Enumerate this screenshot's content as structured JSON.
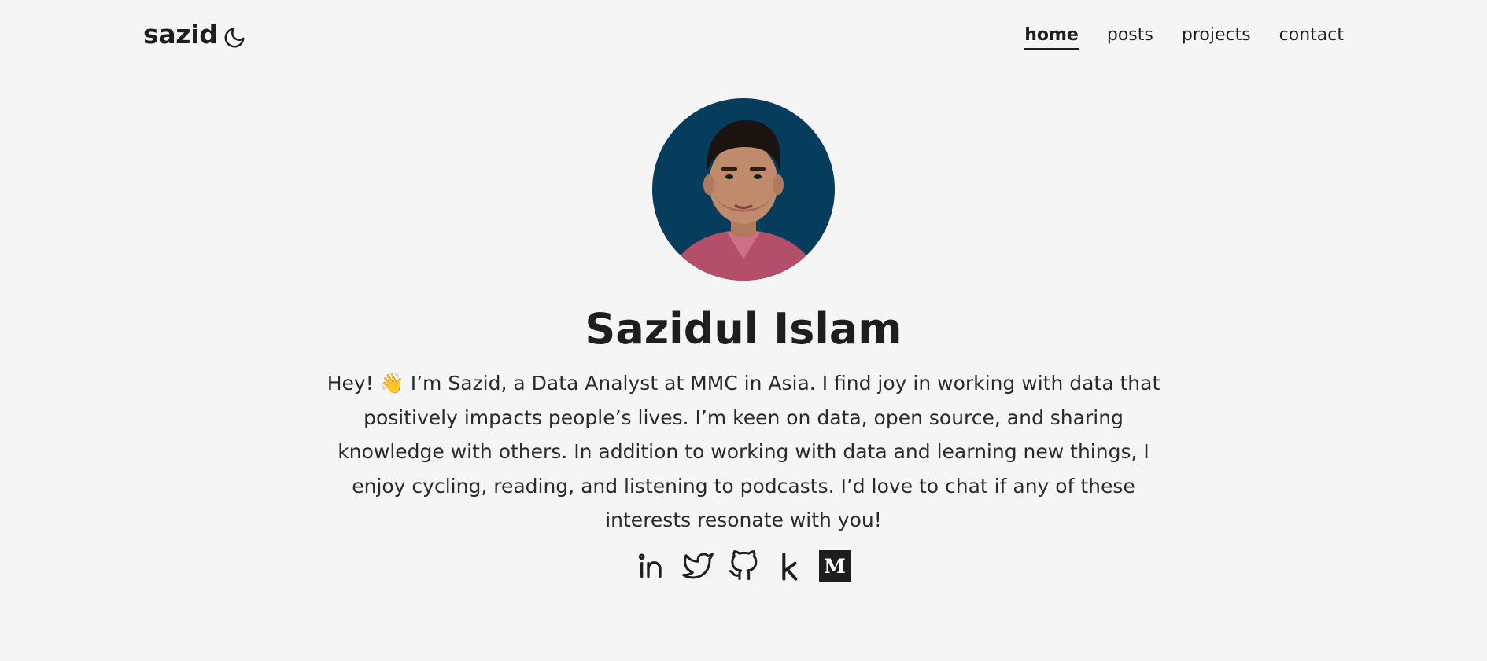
{
  "header": {
    "logo": "sazid",
    "theme_toggle_icon": "moon-icon",
    "nav": [
      {
        "label": "home",
        "active": true
      },
      {
        "label": "posts",
        "active": false
      },
      {
        "label": "projects",
        "active": false
      },
      {
        "label": "contact",
        "active": false
      }
    ]
  },
  "profile": {
    "name": "Sazidul Islam",
    "bio": "Hey! 👋 I’m Sazid, a Data Analyst at MMC in Asia. I find joy in working with data that positively impacts people’s lives. I’m keen on data, open source, and sharing knowledge with others. In addition to working with data and learning new things, I enjoy cycling, reading, and listening to podcasts. I’d love to chat if any of these interests resonate with you!",
    "avatar_bg_color": "#063d5c"
  },
  "socials": [
    {
      "icon": "linkedin-icon"
    },
    {
      "icon": "twitter-icon"
    },
    {
      "icon": "github-icon"
    },
    {
      "icon": "kaggle-icon"
    },
    {
      "icon": "medium-icon"
    }
  ],
  "colors": {
    "background": "#f5f5f5",
    "text": "#1e1e1e"
  }
}
